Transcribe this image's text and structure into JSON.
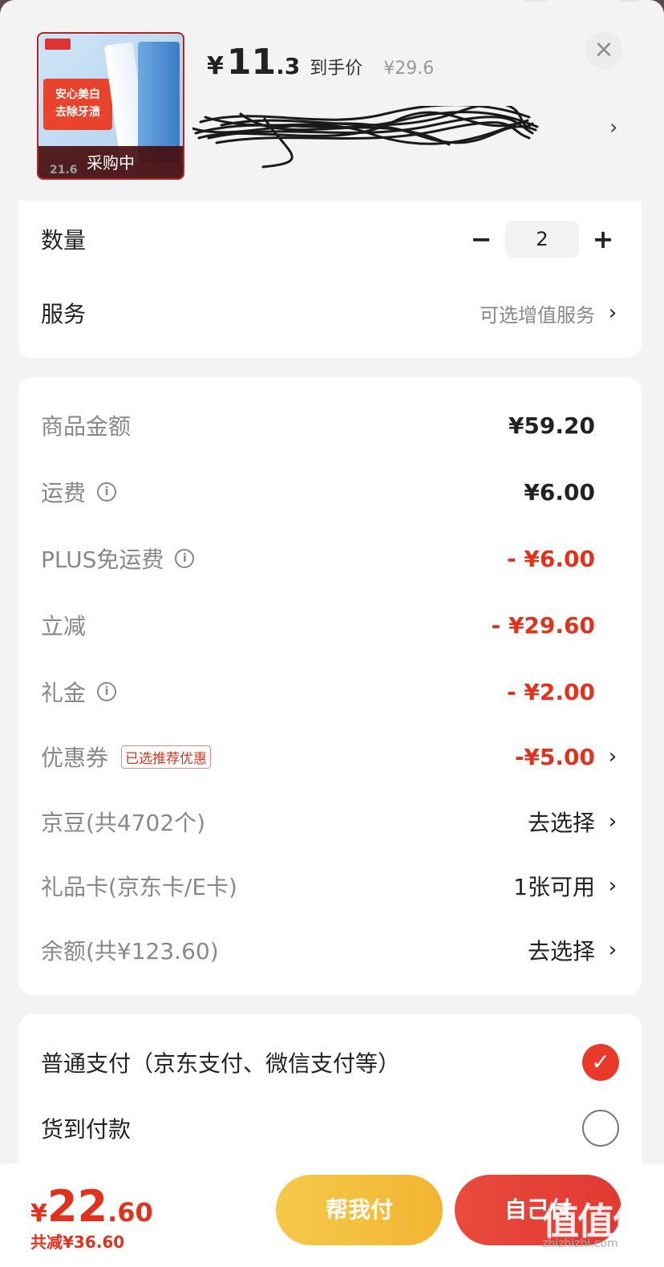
{
  "product": {
    "price_yen": "¥",
    "price_int": "11",
    "price_dec": ".3",
    "price_label": "到手价",
    "original_price": "¥29.6",
    "thumb_promo_line1": "安心美白",
    "thumb_promo_line2": "去除牙渍",
    "thumb_strip_price": "21.6",
    "thumb_overlay": "采购中",
    "close_label": "×",
    "spec_arrow": "›"
  },
  "options": {
    "quantity_label": "数量",
    "quantity_minus": "−",
    "quantity_value": "2",
    "quantity_plus": "+",
    "service_label": "服务",
    "service_value": "可选增值服务"
  },
  "summary": {
    "items": [
      {
        "label": "商品金额",
        "value": "¥59.20"
      },
      {
        "label": "运费",
        "value": "¥6.00"
      },
      {
        "label": "PLUS免运费",
        "value": "- ¥6.00"
      },
      {
        "label": "立减",
        "value": "- ¥29.60"
      },
      {
        "label": "礼金",
        "value": "- ¥2.00"
      },
      {
        "label": "优惠券",
        "tag": "已选推荐优惠",
        "value": "-¥5.00"
      },
      {
        "label": "京豆(共4702个)",
        "value": "去选择"
      },
      {
        "label": "礼品卡(京东卡/E卡)",
        "value": "1张可用"
      },
      {
        "label": "余额(共¥123.60)",
        "value": "去选择"
      }
    ],
    "info_glyph": "i",
    "chevron": "›"
  },
  "payment": {
    "options": [
      {
        "label": "普通支付（京东支付、微信支付等）",
        "selected": true
      },
      {
        "label": "货到付款",
        "selected": false
      }
    ],
    "check_glyph": "✓"
  },
  "footer": {
    "total_yen": "¥",
    "total_int": "22",
    "total_dec": ".60",
    "saved": "共减¥36.60",
    "help_pay": "帮我付",
    "self_pay": "自己付",
    "watermark": "值值值",
    "watermark_sub": "zhizhizhi.com"
  },
  "colors": {
    "accent_red": "#e0321c",
    "help_button": "#f1b532",
    "pay_button": "#e03a32"
  }
}
